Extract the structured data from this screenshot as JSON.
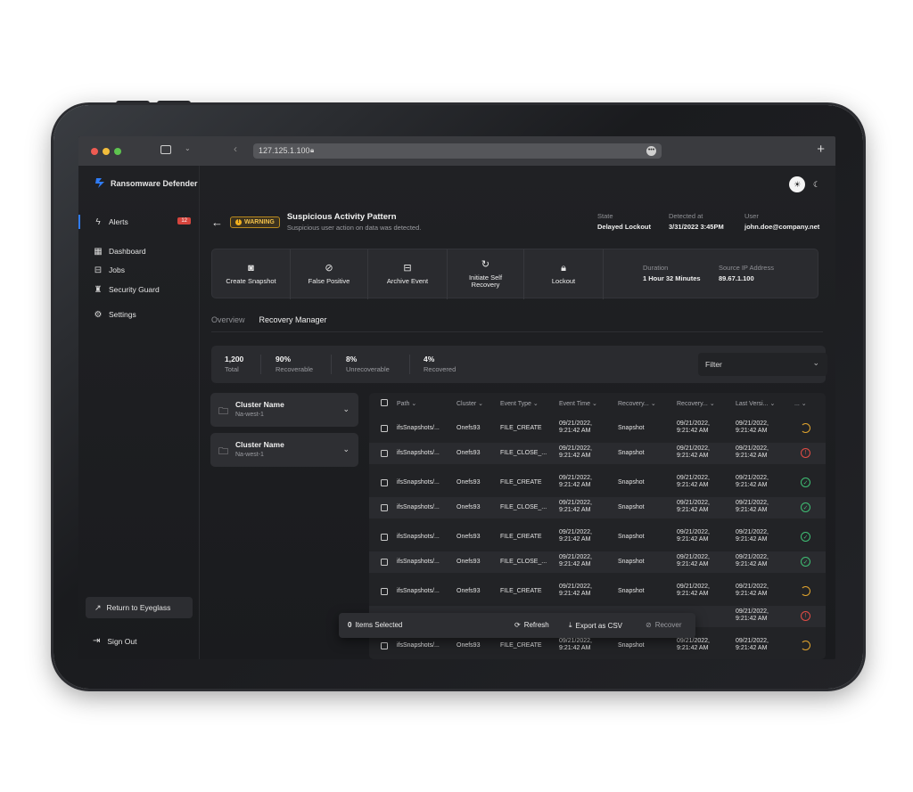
{
  "browser": {
    "url": "127.125.1.100"
  },
  "app": {
    "name": "Ransomware Defender"
  },
  "sidebar": {
    "alerts": {
      "label": "Alerts",
      "count": "12"
    },
    "items": [
      {
        "label": "Dashboard"
      },
      {
        "label": "Jobs"
      },
      {
        "label": "Security Guard"
      },
      {
        "label": "Settings"
      }
    ],
    "return_label": "Return to Eyeglass",
    "signout_label": "Sign Out"
  },
  "alert": {
    "badge": "WARNING",
    "title": "Suspicious Activity Pattern",
    "subtitle": "Suspicious user action on data was detected.",
    "state_label": "State",
    "state_value": "Delayed Lockout",
    "detected_label": "Detected at",
    "detected_value": "3/31/2022 3:45PM",
    "user_label": "User",
    "user_value": "john.doe@company.net"
  },
  "actions": {
    "create_snapshot": "Create Snapshot",
    "false_positive": "False Positive",
    "archive_event": "Archive Event",
    "self_recovery_1": "Initiate Self",
    "self_recovery_2": "Recovery",
    "lockout": "Lockout",
    "duration_label": "Duration",
    "duration_value": "1 Hour 32 Minutes",
    "source_ip_label": "Source IP Address",
    "source_ip_value": "89.67.1.100"
  },
  "tabs": {
    "overview": "Overview",
    "recovery": "Recovery Manager"
  },
  "stats": {
    "total_n": "1,200",
    "total_l": "Total",
    "rec_n": "90%",
    "rec_l": "Recoverable",
    "unrec_n": "8%",
    "unrec_l": "Unrecoverable",
    "recd_n": "4%",
    "recd_l": "Recovered",
    "filter": "Filter"
  },
  "clusters": [
    {
      "name": "Cluster Name",
      "region": "Na-west-1"
    },
    {
      "name": "Cluster Name",
      "region": "Na-west-1"
    }
  ],
  "table": {
    "headers": {
      "path": "Path",
      "cluster": "Cluster",
      "event_type": "Event Type",
      "event_time": "Event Time",
      "recovery1": "Recovery...",
      "recovery2": "Recovery...",
      "last_version": "Last Versi...",
      "more": "..."
    },
    "rows": [
      {
        "path": "ifsSnapshots/...",
        "cluster": "Onefs93",
        "type": "FILE_CREATE",
        "t1": "09/21/2022,",
        "t2": "9:21:42 AM",
        "rec": "Snapshot",
        "r1": "09/21/2022,",
        "r2": "9:21:42 AM",
        "l1": "09/21/2022,",
        "l2": "9:21:42 AM",
        "status": "pending"
      },
      {
        "path": "ifsSnapshots/...",
        "cluster": "Onefs93",
        "type": "FILE_CLOSE_...",
        "t1": "09/21/2022,",
        "t2": "9:21:42 AM",
        "rec": "Snapshot",
        "r1": "09/21/2022,",
        "r2": "9:21:42 AM",
        "l1": "09/21/2022,",
        "l2": "9:21:42 AM",
        "status": "error"
      },
      {
        "path": "ifsSnapshots/...",
        "cluster": "Onefs93",
        "type": "FILE_CREATE",
        "t1": "09/21/2022,",
        "t2": "9:21:42 AM",
        "rec": "Snapshot",
        "r1": "09/21/2022,",
        "r2": "9:21:42 AM",
        "l1": "09/21/2022,",
        "l2": "9:21:42 AM",
        "status": "ok"
      },
      {
        "path": "ifsSnapshots/...",
        "cluster": "Onefs93",
        "type": "FILE_CLOSE_...",
        "t1": "09/21/2022,",
        "t2": "9:21:42 AM",
        "rec": "Snapshot",
        "r1": "09/21/2022,",
        "r2": "9:21:42 AM",
        "l1": "09/21/2022,",
        "l2": "9:21:42 AM",
        "status": "ok"
      },
      {
        "path": "ifsSnapshots/...",
        "cluster": "Onefs93",
        "type": "FILE_CREATE",
        "t1": "09/21/2022,",
        "t2": "9:21:42 AM",
        "rec": "Snapshot",
        "r1": "09/21/2022,",
        "r2": "9:21:42 AM",
        "l1": "09/21/2022,",
        "l2": "9:21:42 AM",
        "status": "ok"
      },
      {
        "path": "ifsSnapshots/...",
        "cluster": "Onefs93",
        "type": "FILE_CLOSE_...",
        "t1": "09/21/2022,",
        "t2": "9:21:42 AM",
        "rec": "Snapshot",
        "r1": "09/21/2022,",
        "r2": "9:21:42 AM",
        "l1": "09/21/2022,",
        "l2": "9:21:42 AM",
        "status": "ok"
      },
      {
        "path": "ifsSnapshots/...",
        "cluster": "Onefs93",
        "type": "FILE_CREATE",
        "t1": "09/21/2022,",
        "t2": "9:21:42 AM",
        "rec": "Snapshot",
        "r1": "09/21/2022,",
        "r2": "9:21:42 AM",
        "l1": "09/21/2022,",
        "l2": "9:21:42 AM",
        "status": "pending"
      },
      {
        "path": "",
        "cluster": "",
        "type": "",
        "t1": "",
        "t2": "",
        "rec": "",
        "r1": "",
        "r2": "",
        "l1": "09/21/2022,",
        "l2": "9:21:42 AM",
        "status": "error"
      },
      {
        "path": "ifsSnapshots/...",
        "cluster": "Onefs93",
        "type": "FILE_CREATE",
        "t1": "09/21/2022,",
        "t2": "9:21:42 AM",
        "rec": "Snapshot",
        "r1": "09/21/2022,",
        "r2": "9:21:42 AM",
        "l1": "09/21/2022,",
        "l2": "9:21:42 AM",
        "status": "pending"
      }
    ]
  },
  "selection": {
    "count": "0",
    "label": "Items Selected",
    "refresh": "Refresh",
    "export": "Export as CSV",
    "recover": "Recover"
  },
  "colors": {
    "accent": "#2f7cf6",
    "warning": "#f2c04a",
    "error": "#e24c45",
    "ok": "#3fbf74",
    "pending": "#e3a52e"
  }
}
